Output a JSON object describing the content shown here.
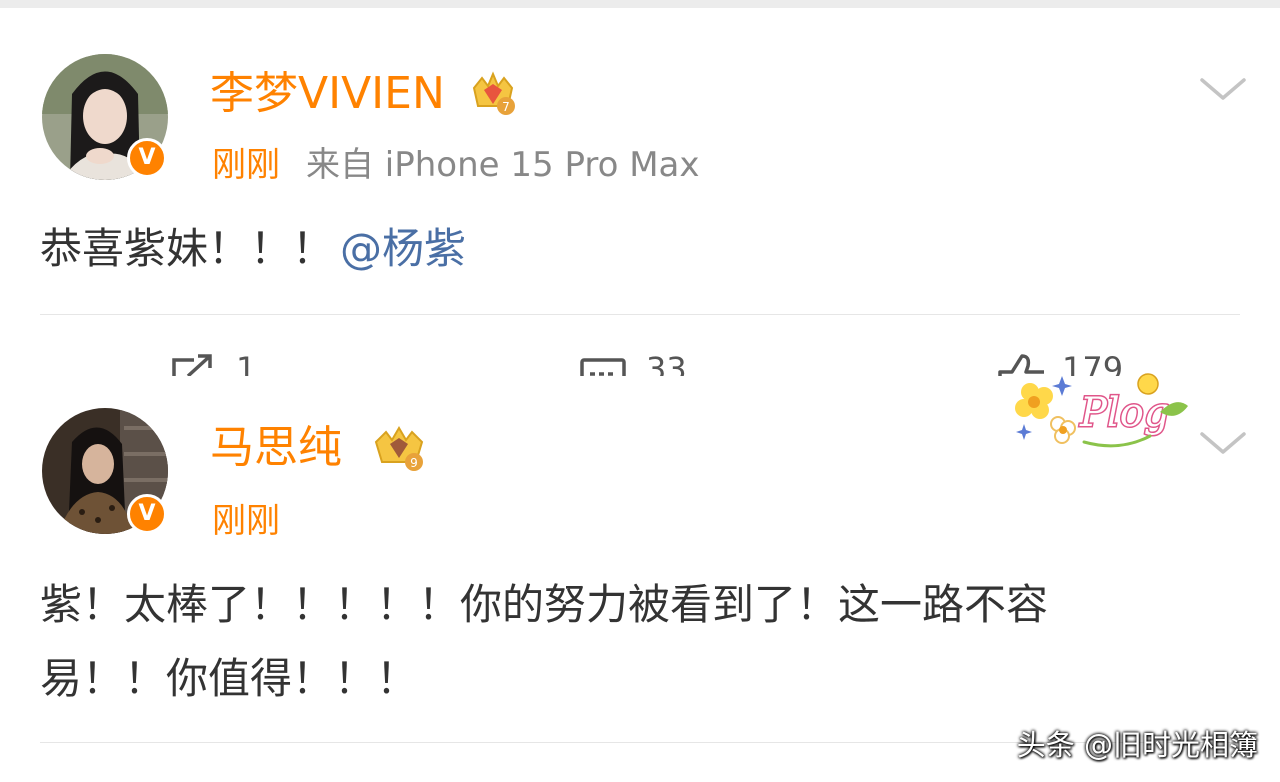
{
  "posts": [
    {
      "author": "李梦VIVIEN",
      "time": "刚刚",
      "source": "来自 iPhone 15 Pro Max",
      "text": "恭喜紫妹！！！",
      "mention": "@杨紫",
      "badge_level": "7",
      "actions": {
        "repost": "1",
        "comment": "33",
        "like": "179"
      }
    },
    {
      "author": "马思纯",
      "time": "刚刚",
      "text_line1": "紫！太棒了！！！！！你的努力被看到了！这一路不容",
      "text_line2": "易！！你值得！！！",
      "badge_level": "9"
    }
  ],
  "verified_mark": "V",
  "sticker_text": "Plog",
  "watermark": "头条 @旧时光相簿",
  "colors": {
    "accent": "#ff8200",
    "link": "#4a6fa5",
    "text": "#333333",
    "meta": "#888888"
  },
  "icons": {
    "repost": "repost-icon",
    "comment": "comment-icon",
    "like": "like-icon",
    "more": "chevron-down-icon",
    "crown": "crown-badge-icon"
  }
}
